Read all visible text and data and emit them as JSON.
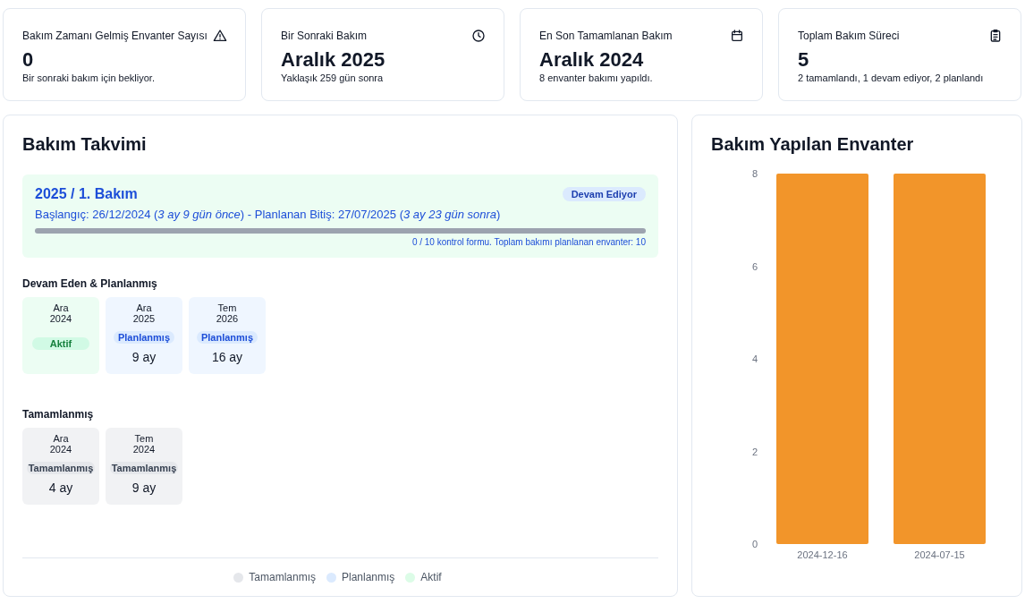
{
  "stats": [
    {
      "title": "Bakım Zamanı Gelmiş Envanter Sayısı",
      "value": "0",
      "note": "Bir sonraki bakım için bekliyor."
    },
    {
      "title": "Bir Sonraki Bakım",
      "value": "Aralık 2025",
      "note": "Yaklaşık 259 gün sonra"
    },
    {
      "title": "En Son Tamamlanan Bakım",
      "value": "Aralık 2024",
      "note": "8 envanter bakımı yapıldı."
    },
    {
      "title": "Toplam Bakım Süreci",
      "value": "5",
      "note": "2 tamamlandı, 1 devam ediyor, 2 planlandı"
    }
  ],
  "schedule": {
    "title": "Bakım Takvimi",
    "current": {
      "title": "2025 / 1. Bakım",
      "status": "Devam Ediyor",
      "dates": "Başlangıç: 26/12/2024 (*3 ay 9 gün önce*) - Planlanan Bitiş: 27/07/2025 (*3 ay 23 gün sonra*)",
      "level": 0,
      "footer": "0 / 10 kontrol formu. Toplam bakımı planlanan envanter: 10"
    },
    "sections": [
      {
        "heading": "Devam Eden & Planlanmış",
        "items": [
          {
            "kind": "active",
            "month": "Ara",
            "year": "2024",
            "badge": "Aktif"
          },
          {
            "kind": "planned",
            "month": "Ara",
            "year": "2025",
            "badge": "Planlanmış",
            "duration": "9 ay"
          },
          {
            "kind": "planned",
            "month": "Tem",
            "year": "2026",
            "badge": "Planlanmış",
            "duration": "16 ay"
          }
        ]
      },
      {
        "heading": "Tamamlanmış",
        "items": [
          {
            "kind": "completed",
            "month": "Ara",
            "year": "2024",
            "badge": "Tamamlanmış",
            "duration": "4 ay"
          },
          {
            "kind": "completed",
            "month": "Tem",
            "year": "2024",
            "badge": "Tamamlanmış",
            "duration": "9 ay"
          }
        ]
      }
    ],
    "legend": [
      {
        "label": "Tamamlanmış",
        "color": "#e5e7eb"
      },
      {
        "label": "Planlanmış",
        "color": "#dbeafe"
      },
      {
        "label": "Aktif",
        "color": "#dcfce7"
      }
    ]
  },
  "inventory": {
    "title": "Bakım Yapılan Envanter",
    "chart_data": {
      "type": "bar",
      "categories": [
        "2024-12-16",
        "2024-07-15"
      ],
      "series": [
        {
          "color": "#f2952a",
          "values": [
            8,
            8
          ]
        }
      ],
      "ylim": [
        0,
        8
      ],
      "yticks": [
        0,
        2,
        4,
        6,
        8
      ]
    }
  }
}
